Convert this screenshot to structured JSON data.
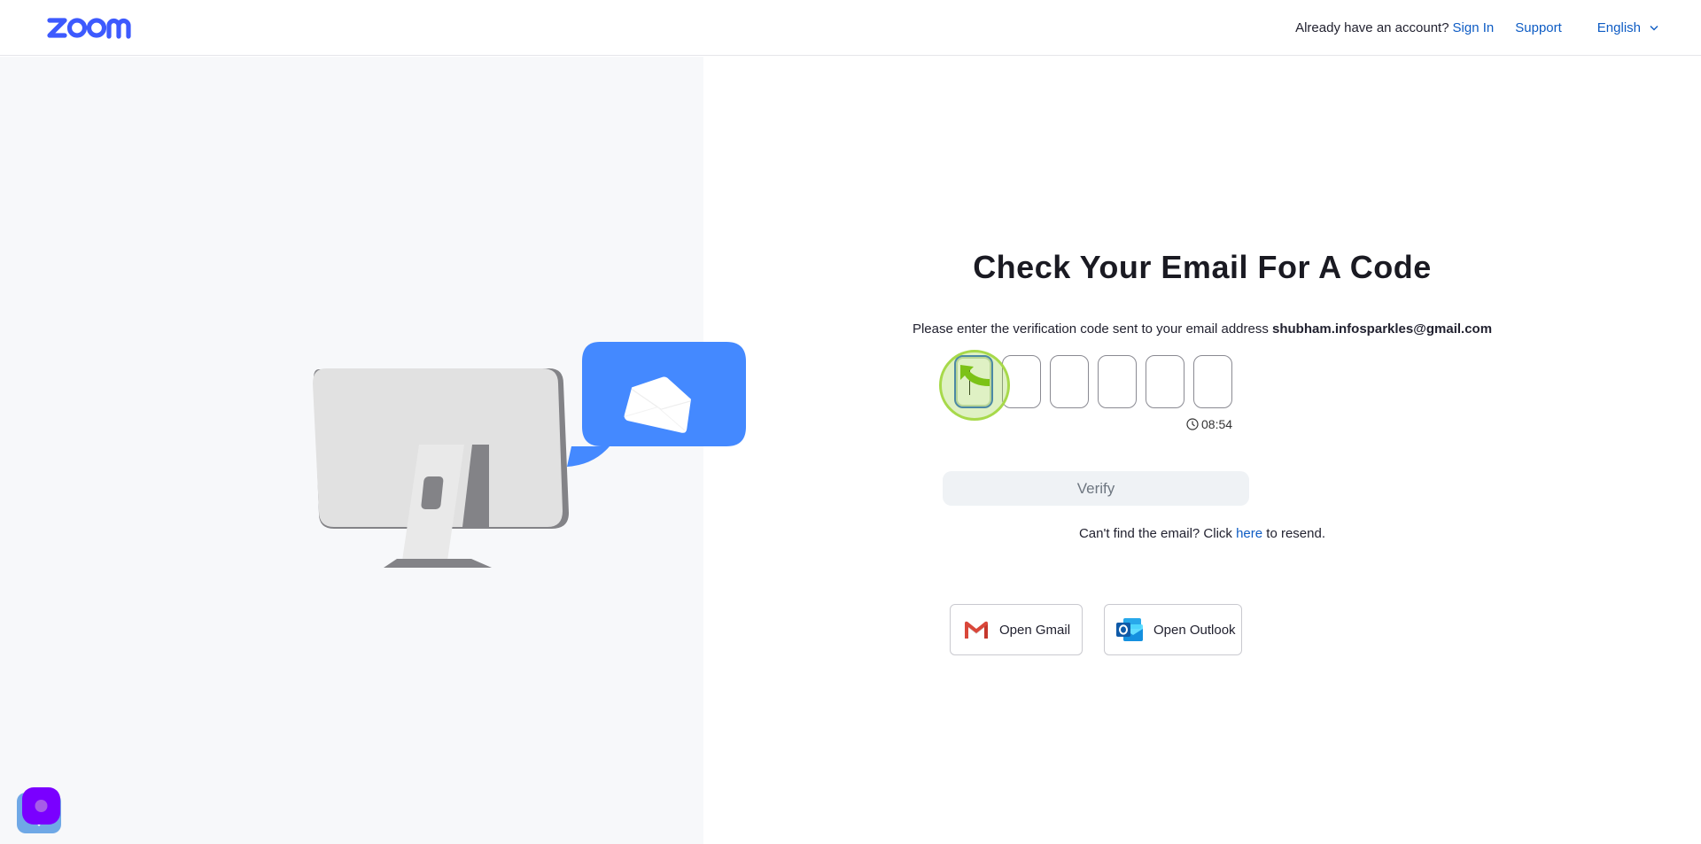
{
  "header": {
    "logo_text": "zoom",
    "account_prompt": "Already have an account?",
    "sign_in": "Sign In",
    "support": "Support",
    "language": "English"
  },
  "main": {
    "title": "Check Your Email For A Code",
    "instruction": "Please enter the verification code sent to your email address",
    "email": "shubham.infosparkles@gmail.com",
    "code_digits": [
      "",
      "",
      "",
      "",
      "",
      ""
    ],
    "timer": "08:54",
    "verify_label": "Verify",
    "resend_prefix": "Can't find the email? Click",
    "resend_link": "here",
    "resend_suffix": "to resend.",
    "open_gmail": "Open Gmail",
    "open_outlook": "Open Outlook"
  },
  "icons": {
    "logo": "zoom-logo",
    "language_chevron": "chevron-down-icon",
    "timer": "clock-icon",
    "gmail": "gmail-icon",
    "outlook": "outlook-icon",
    "illustration": "monitor-with-email-bubble",
    "widget": "chat-widget-icon"
  },
  "colors": {
    "brand": "#3d5afe",
    "link": "#0e5cc4",
    "bubble": "#4489ff",
    "widget": "#7a00ff"
  }
}
